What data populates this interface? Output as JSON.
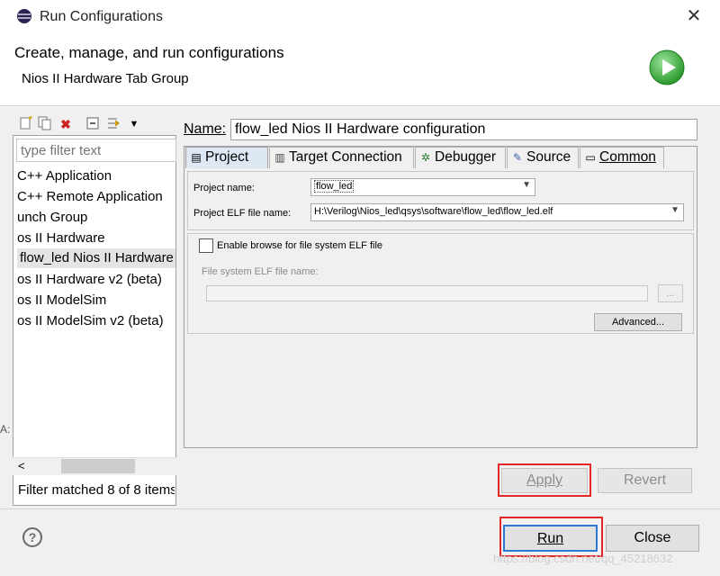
{
  "window": {
    "title": "Run Configurations"
  },
  "header": {
    "title": "Create, manage, and run configurations",
    "subtitle": "Nios II Hardware Tab Group"
  },
  "left": {
    "toolbar_icons": [
      "new-config-icon",
      "duplicate-icon",
      "delete-icon",
      "collapse-all-icon",
      "filter-icon",
      "chevron-down-icon"
    ],
    "filter_placeholder": "type filter text",
    "items": [
      {
        "label": "C++ Application"
      },
      {
        "label": "C++ Remote Application"
      },
      {
        "label": "unch Group"
      },
      {
        "label": "os II Hardware"
      },
      {
        "label": "flow_led Nios II Hardware configuration",
        "selected": true
      },
      {
        "label": "os II Hardware v2 (beta)"
      },
      {
        "label": "os II ModelSim"
      },
      {
        "label": "os II ModelSim v2 (beta)"
      }
    ],
    "scroll_left_glyph": "<",
    "status": "Filter matched 8 of 8 items",
    "edge_glyph": "A:"
  },
  "right": {
    "name_label": "Name:",
    "name_value": "flow_led Nios II Hardware configuration",
    "tabs": [
      {
        "label": "Project",
        "active": true
      },
      {
        "label": "Target Connection"
      },
      {
        "label": "Debugger"
      },
      {
        "label": "Source"
      },
      {
        "label": "Common"
      }
    ],
    "project": {
      "project_name_label": "Project name:",
      "project_name_value": "flow_led",
      "elf_label": "Project ELF file name:",
      "elf_value": "H:\\Verilog\\Nios_led\\qsys\\software\\flow_led\\flow_led.elf",
      "browse_checkbox_label": "Enable browse for file system ELF file",
      "browse_checked": false,
      "fs_elf_label": "File system ELF file name:",
      "fs_elf_value": "",
      "browse_button": "...",
      "advanced_button": "Advanced..."
    },
    "apply_button": "Apply",
    "revert_button": "Revert"
  },
  "footer": {
    "help_glyph": "?",
    "run_button": "Run",
    "close_button": "Close",
    "watermark": "https://blog.csdn.net/qq_45218632"
  },
  "colors": {
    "highlight": "#e32626",
    "run_icon": "#3cae3c",
    "active_tab": "#dde8f4"
  }
}
